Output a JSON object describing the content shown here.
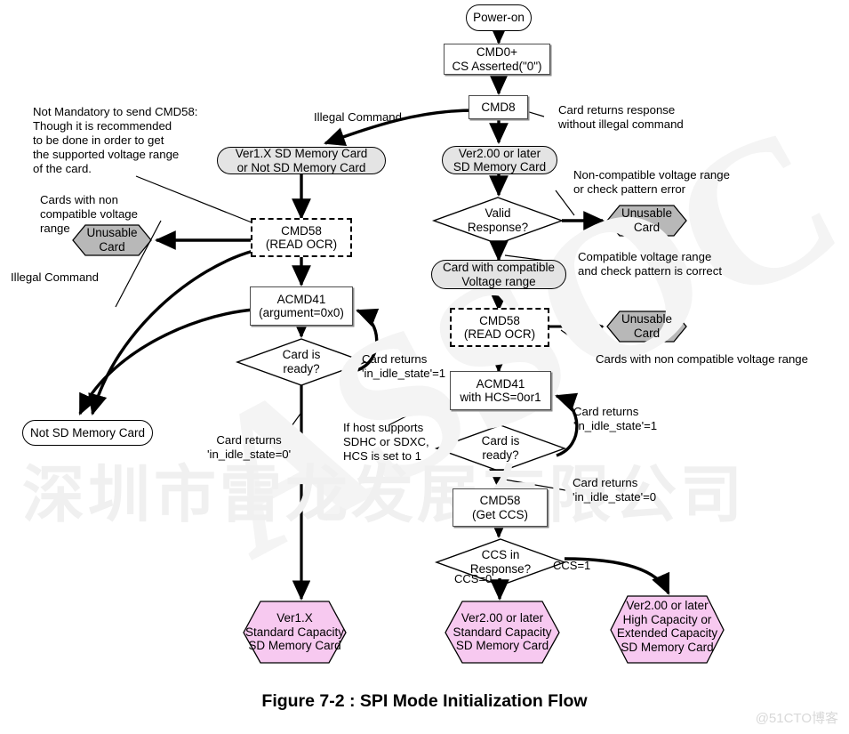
{
  "figure": {
    "title": "Figure 7-2 : SPI Mode Initialization Flow",
    "corner_watermark": "@51CTO博客",
    "background_watermark_cn": "深圳市雷龙发展有限公司",
    "background_watermark_ascii": "ASSOC"
  },
  "colors": {
    "unusable_fill": "#b8b8b8",
    "result_fill": "#f7c9f0",
    "state_fill": "#e4e4e4",
    "process_fill": "#ffffff",
    "stroke": "#000000"
  },
  "nodes": {
    "power_on": {
      "label": "Power-on",
      "shape": "terminator"
    },
    "cmd0": {
      "label": "CMD0+\nCS Asserted(\"0\")",
      "shape": "process"
    },
    "cmd8": {
      "label": "CMD8",
      "shape": "process"
    },
    "ver1x_card": {
      "label": "Ver1.X SD Memory Card\nor Not SD Memory Card",
      "shape": "state"
    },
    "ver2_card": {
      "label": "Ver2.00 or later\nSD Memory Card",
      "shape": "state"
    },
    "cmd58_left": {
      "label": "CMD58\n(READ OCR)",
      "shape": "process-dashed"
    },
    "acmd41_left": {
      "label": "ACMD41\n(argument=0x0)",
      "shape": "process"
    },
    "card_ready_left": {
      "label": "Card is\nready?",
      "shape": "decision"
    },
    "valid_response": {
      "label": "Valid\nResponse?",
      "shape": "decision"
    },
    "compatible_voltage": {
      "label": "Card with compatible\nVoltage range",
      "shape": "state"
    },
    "cmd58_right": {
      "label": "CMD58\n(READ OCR)",
      "shape": "process-dashed"
    },
    "acmd41_right": {
      "label": "ACMD41\nwith HCS=0or1",
      "shape": "process"
    },
    "card_ready_right": {
      "label": "Card is\nready?",
      "shape": "decision"
    },
    "cmd58_get_ccs": {
      "label": "CMD58\n(Get CCS)",
      "shape": "process"
    },
    "ccs_in_response": {
      "label": "CCS in\nResponse?",
      "shape": "decision"
    },
    "unusable_card_left": {
      "label": "Unusable\nCard",
      "shape": "hexagon"
    },
    "unusable_card_top_right": {
      "label": "Unusable\nCard",
      "shape": "hexagon"
    },
    "unusable_card_mid_right": {
      "label": "Unusable\nCard",
      "shape": "hexagon"
    },
    "not_sd_memory_card": {
      "label": "Not SD Memory Card",
      "shape": "terminator"
    },
    "result_ver1x": {
      "label": "Ver1.X\nStandard Capacity\nSD Memory Card",
      "shape": "hexagon"
    },
    "result_ver2_standard": {
      "label": "Ver2.00 or later\nStandard Capacity\nSD Memory Card",
      "shape": "hexagon"
    },
    "result_ver2_high": {
      "label": "Ver2.00 or later\nHigh Capacity or\nExtended Capacity\nSD Memory Card",
      "shape": "hexagon"
    }
  },
  "annotations": {
    "not_mandatory_cmd58": "Not Mandatory to send CMD58:\nThough it is recommended\nto be done in order to get\nthe supported voltage range\nof the card.",
    "cards_non_compatible_left": "Cards with non\ncompatible voltage\nrange",
    "illegal_command_left": "Illegal Command",
    "illegal_command_top": "Illegal Command",
    "card_returns_response": "Card returns response\nwithout illegal command",
    "non_compatible_or_pattern": "Non-compatible voltage range\nor check pattern error",
    "compatible_and_pattern": "Compatible voltage range\nand check pattern is correct",
    "cards_non_compatible_right": "Cards with non compatible voltage range",
    "card_returns_idle1_left": "Card returns\n'in_idle_state'=1",
    "card_returns_idle0_left": "Card returns\n'in_idle_state=0'",
    "card_returns_idle1_right": "Card returns\n'in_idle_state'=1",
    "card_returns_idle0_right": "Card returns\n'in_idle_state'=0",
    "if_host_supports": "If host supports\nSDHC or SDXC,\nHCS is set to 1",
    "ccs_zero": "CCS=0",
    "ccs_one": "CCS=1"
  }
}
